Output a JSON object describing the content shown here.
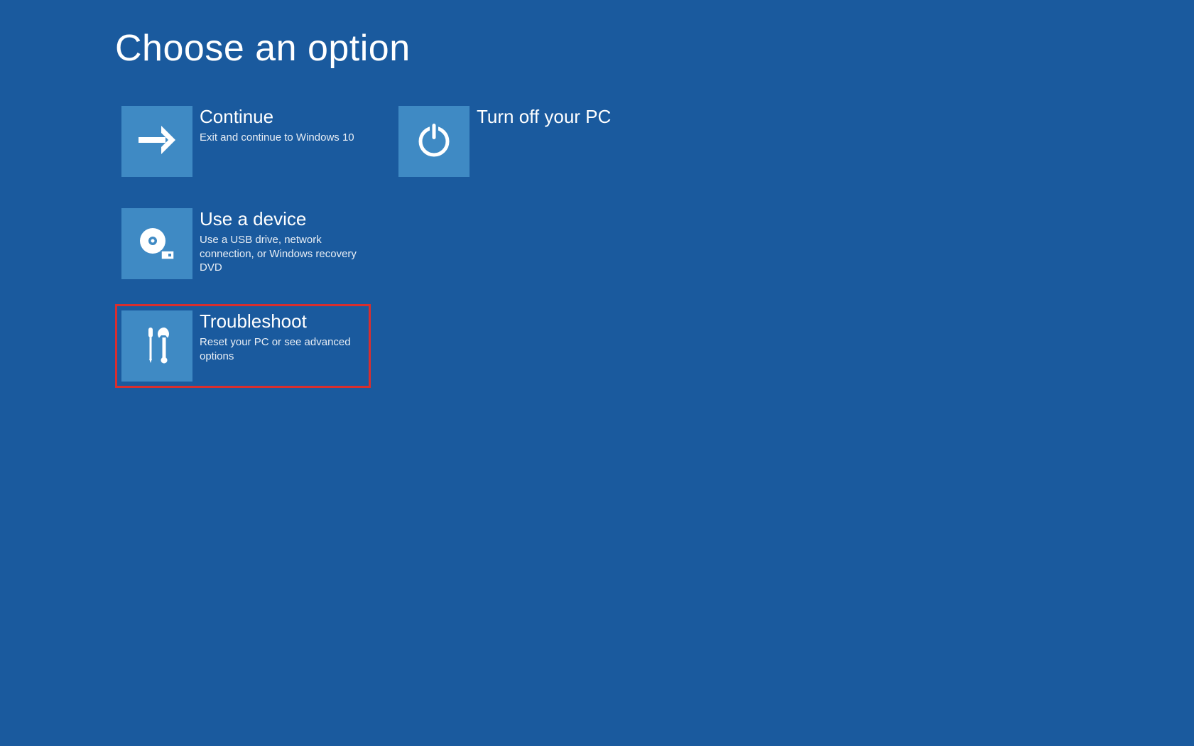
{
  "page": {
    "title": "Choose an option"
  },
  "options": {
    "continue": {
      "title": "Continue",
      "description": "Exit and continue to Windows 10",
      "icon": "arrow-right-icon"
    },
    "use_device": {
      "title": "Use a device",
      "description": "Use a USB drive, network connection, or Windows recovery DVD",
      "icon": "device-icon"
    },
    "troubleshoot": {
      "title": "Troubleshoot",
      "description": "Reset your PC or see advanced options",
      "icon": "tools-icon",
      "highlighted": true
    },
    "turn_off": {
      "title": "Turn off your PC",
      "description": "",
      "icon": "power-icon"
    }
  },
  "colors": {
    "background": "#1a5a9e",
    "tile": "#3f8ac4",
    "highlight_border": "#d92e2e",
    "text": "#ffffff"
  }
}
